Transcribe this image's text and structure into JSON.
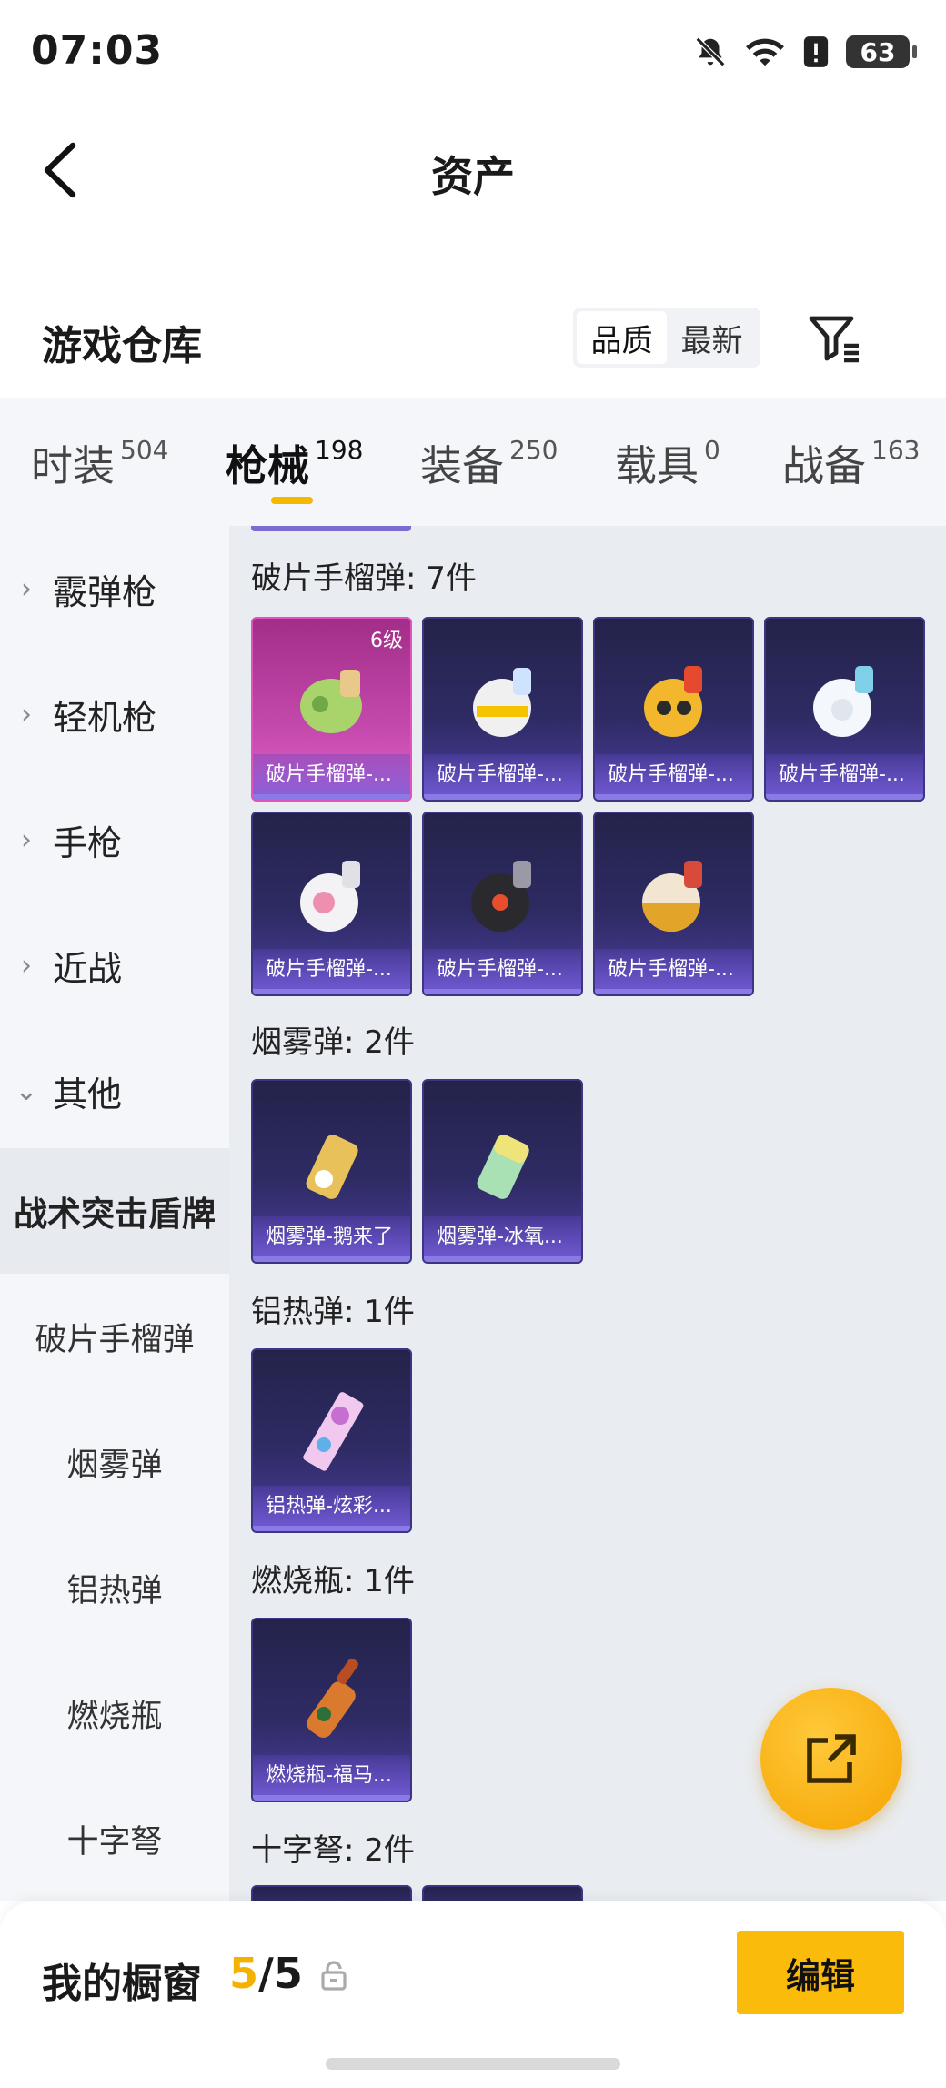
{
  "status": {
    "time": "07:03",
    "battery": "63"
  },
  "nav": {
    "title": "资产"
  },
  "warehouse": {
    "title": "游戏仓库",
    "sort_options": [
      "品质",
      "最新"
    ]
  },
  "tabs": [
    {
      "label": "时装",
      "count": "504"
    },
    {
      "label": "枪械",
      "count": "198"
    },
    {
      "label": "装备",
      "count": "250"
    },
    {
      "label": "载具",
      "count": "0"
    },
    {
      "label": "战备",
      "count": "163"
    }
  ],
  "sidebar": {
    "categories": [
      "霰弹枪",
      "轻机枪",
      "手枪",
      "近战",
      "其他"
    ],
    "selected": "战术突击盾牌",
    "subs": [
      "破片手榴弹",
      "烟雾弹",
      "铝热弹",
      "燃烧瓶",
      "十字弩"
    ]
  },
  "sections": [
    {
      "title": "破片手榴弹: 7件",
      "items": [
        {
          "label": "破片手榴弹-...",
          "level": "6级"
        },
        {
          "label": "破片手榴弹-..."
        },
        {
          "label": "破片手榴弹-..."
        },
        {
          "label": "破片手榴弹-..."
        },
        {
          "label": "破片手榴弹-..."
        },
        {
          "label": "破片手榴弹-..."
        },
        {
          "label": "破片手榴弹-..."
        }
      ]
    },
    {
      "title": "烟雾弹: 2件",
      "items": [
        {
          "label": "烟雾弹-鹅来了"
        },
        {
          "label": "烟雾弹-冰氧..."
        }
      ]
    },
    {
      "title": "铝热弹: 1件",
      "items": [
        {
          "label": "铝热弹-炫彩..."
        }
      ]
    },
    {
      "title": "燃烧瓶: 1件",
      "items": [
        {
          "label": "燃烧瓶-福马..."
        }
      ]
    },
    {
      "title": "十字弩: 2件",
      "items": []
    }
  ],
  "bottom": {
    "title": "我的橱窗",
    "count_current": "5",
    "count_sep": "/",
    "count_total": "5",
    "edit_label": "编辑"
  },
  "colors": {
    "accent": "#fbbb0b",
    "item_bg": "#2e2b64",
    "item_rare": "#c449ad"
  }
}
